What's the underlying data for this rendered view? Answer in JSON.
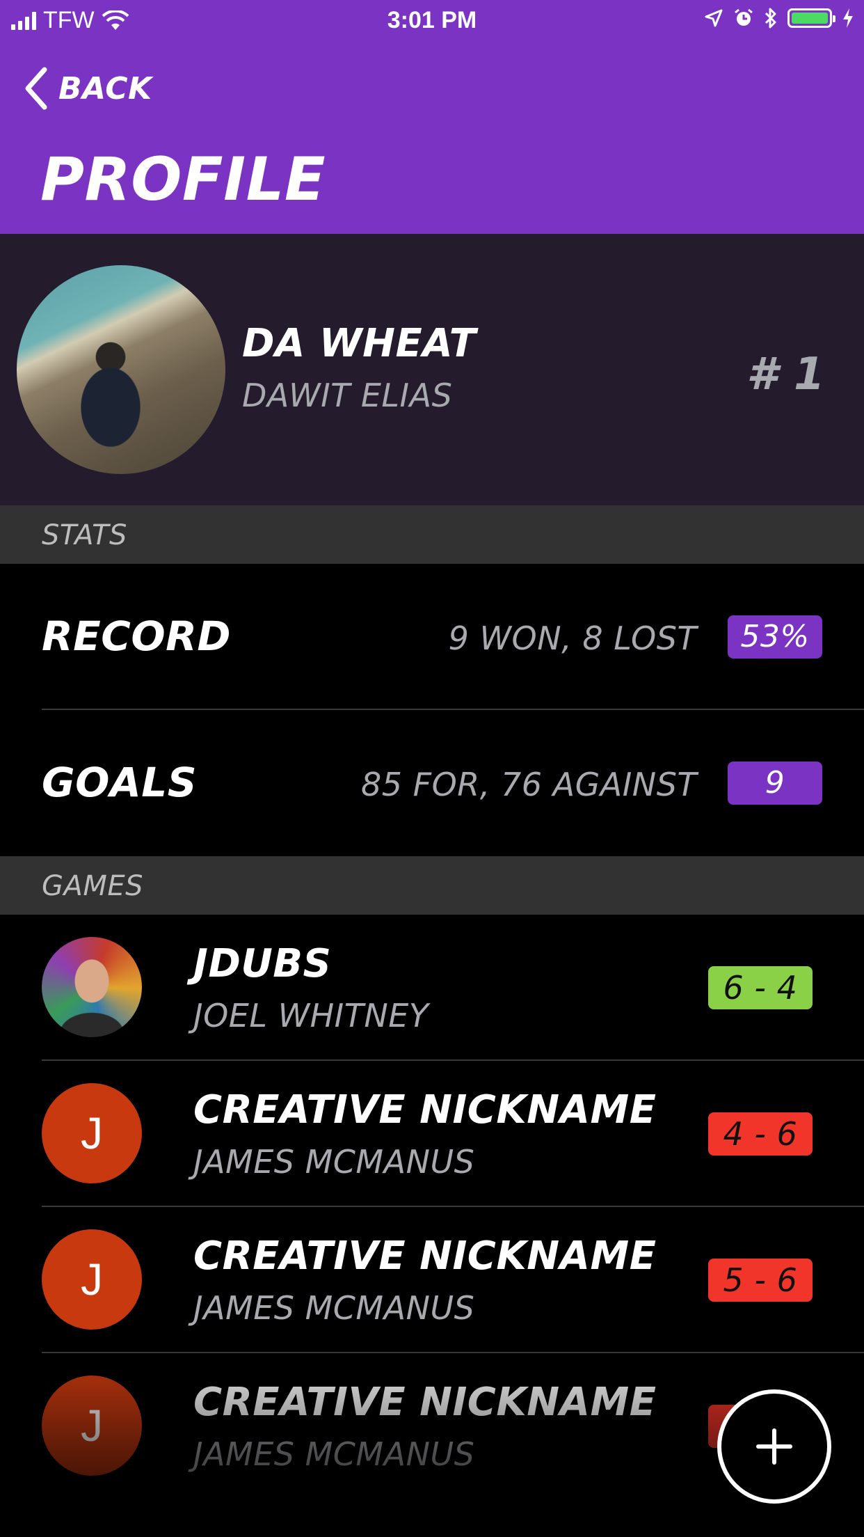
{
  "status_bar": {
    "carrier": "TFW",
    "time": "3:01 PM",
    "battery_color": "#4cd964"
  },
  "header": {
    "back_label": "BACK",
    "title": "PROFILE",
    "background_color": "#7b33c4"
  },
  "profile": {
    "nickname": "DA WHEAT",
    "full_name": "DAWIT ELIAS",
    "rank": "# 1"
  },
  "stats": {
    "section_label": "STATS",
    "rows": [
      {
        "label": "RECORD",
        "value": "9 WON, 8 LOST",
        "badge": "53%"
      },
      {
        "label": "GOALS",
        "value": "85 FOR, 76 AGAINST",
        "badge": "9"
      }
    ]
  },
  "games": {
    "section_label": "GAMES",
    "rows": [
      {
        "avatar": "photo",
        "nickname": "JDUBS",
        "name": "JOEL WHITNEY",
        "score": "6 - 4",
        "result_color": "#8bd148"
      },
      {
        "avatar": "J",
        "nickname": "CREATIVE NICKNAME",
        "name": "JAMES MCMANUS",
        "score": "4 - 6",
        "result_color": "#f2352a"
      },
      {
        "avatar": "J",
        "nickname": "CREATIVE NICKNAME",
        "name": "JAMES MCMANUS",
        "score": "5 - 6",
        "result_color": "#f2352a"
      },
      {
        "avatar": "J",
        "nickname": "CREATIVE NICKNAME",
        "name": "JAMES MCMANUS",
        "score": "",
        "result_color": "#f2352a"
      }
    ]
  },
  "fab": {
    "icon": "plus-icon"
  }
}
